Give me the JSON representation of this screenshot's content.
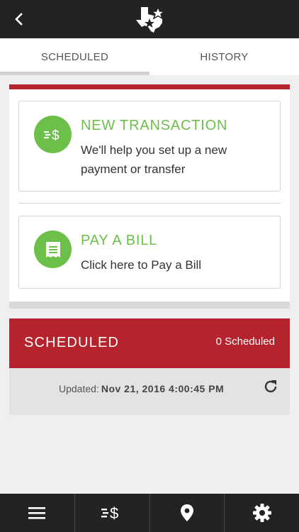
{
  "header": {
    "back_icon": "chevron-left-icon",
    "logo_icon": "texas-star-logo"
  },
  "tabs": [
    {
      "label": "SCHEDULED",
      "active": true
    },
    {
      "label": "HISTORY",
      "active": false
    }
  ],
  "actions": [
    {
      "icon": "transfer-dollar-icon",
      "title": "NEW TRANSACTION",
      "description": "We'll help you set up a new payment or transfer"
    },
    {
      "icon": "bill-icon",
      "title": "PAY A BILL",
      "description": "Click here to Pay a Bill"
    }
  ],
  "scheduled": {
    "title": "SCHEDULED",
    "count_label": "0 Scheduled",
    "updated_label": "Updated:",
    "updated_date": "Nov 21, 2016 4:00:45 PM",
    "refresh_icon": "refresh-icon"
  },
  "bottom_nav": [
    {
      "icon": "menu-icon"
    },
    {
      "icon": "transfer-dollar-icon"
    },
    {
      "icon": "location-pin-icon"
    },
    {
      "icon": "settings-gear-icon"
    }
  ],
  "colors": {
    "header_bg": "#232323",
    "accent_red": "#b5232d",
    "accent_green": "#6cc04a",
    "page_bg": "#efefef"
  }
}
